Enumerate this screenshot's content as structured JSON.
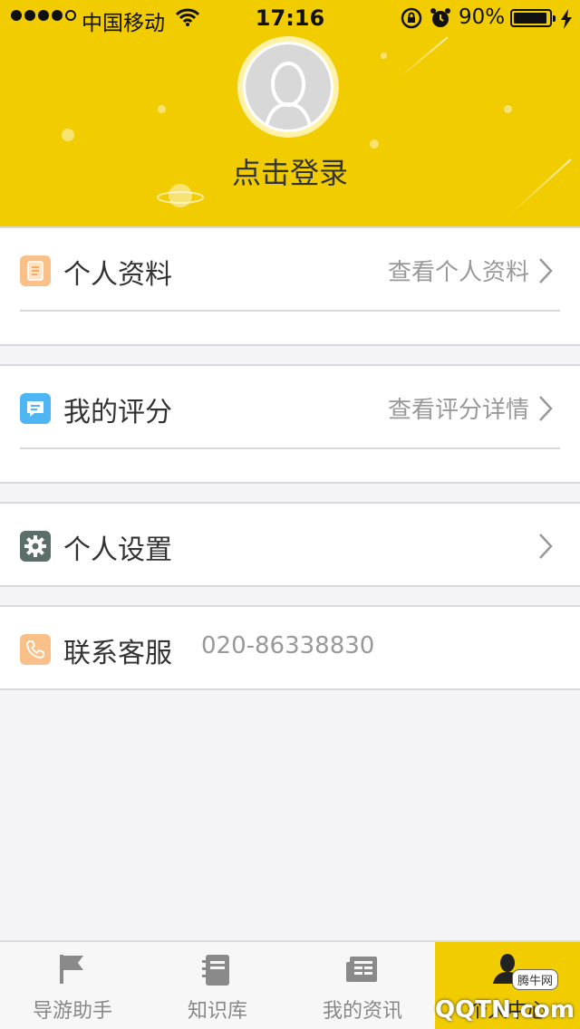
{
  "status_bar": {
    "carrier": "中国移动",
    "time": "17:16",
    "battery_percent": "90%",
    "signal_bars": 4
  },
  "profile": {
    "login_text": "点击登录"
  },
  "menu": {
    "profile_row": {
      "label": "个人资料",
      "detail": "查看个人资料",
      "icon": "document-icon",
      "icon_color": "#f9c089"
    },
    "rating_row": {
      "label": "我的评分",
      "detail": "查看评分详情",
      "icon": "message-icon",
      "icon_color": "#4fb6f3"
    },
    "settings_row": {
      "label": "个人设置",
      "icon": "gear-icon",
      "icon_color": "#5b6e6a"
    },
    "service_row": {
      "label": "联系客服",
      "phone": "020-86338830",
      "icon": "phone-icon",
      "icon_color": "#f9c089"
    }
  },
  "tabbar": {
    "tabs": [
      {
        "label": "导游助手",
        "icon": "flag-icon"
      },
      {
        "label": "知识库",
        "icon": "notebook-icon"
      },
      {
        "label": "我的资讯",
        "icon": "newspaper-icon"
      },
      {
        "label": "个人中心",
        "icon": "person-icon",
        "active": true
      }
    ]
  },
  "watermark": {
    "text": "QQTN.com",
    "badge": "腾牛网"
  },
  "colors": {
    "brand_yellow": "#f1cc00",
    "background": "#f4f4f6",
    "text_primary": "#333333",
    "text_secondary": "#999999"
  }
}
